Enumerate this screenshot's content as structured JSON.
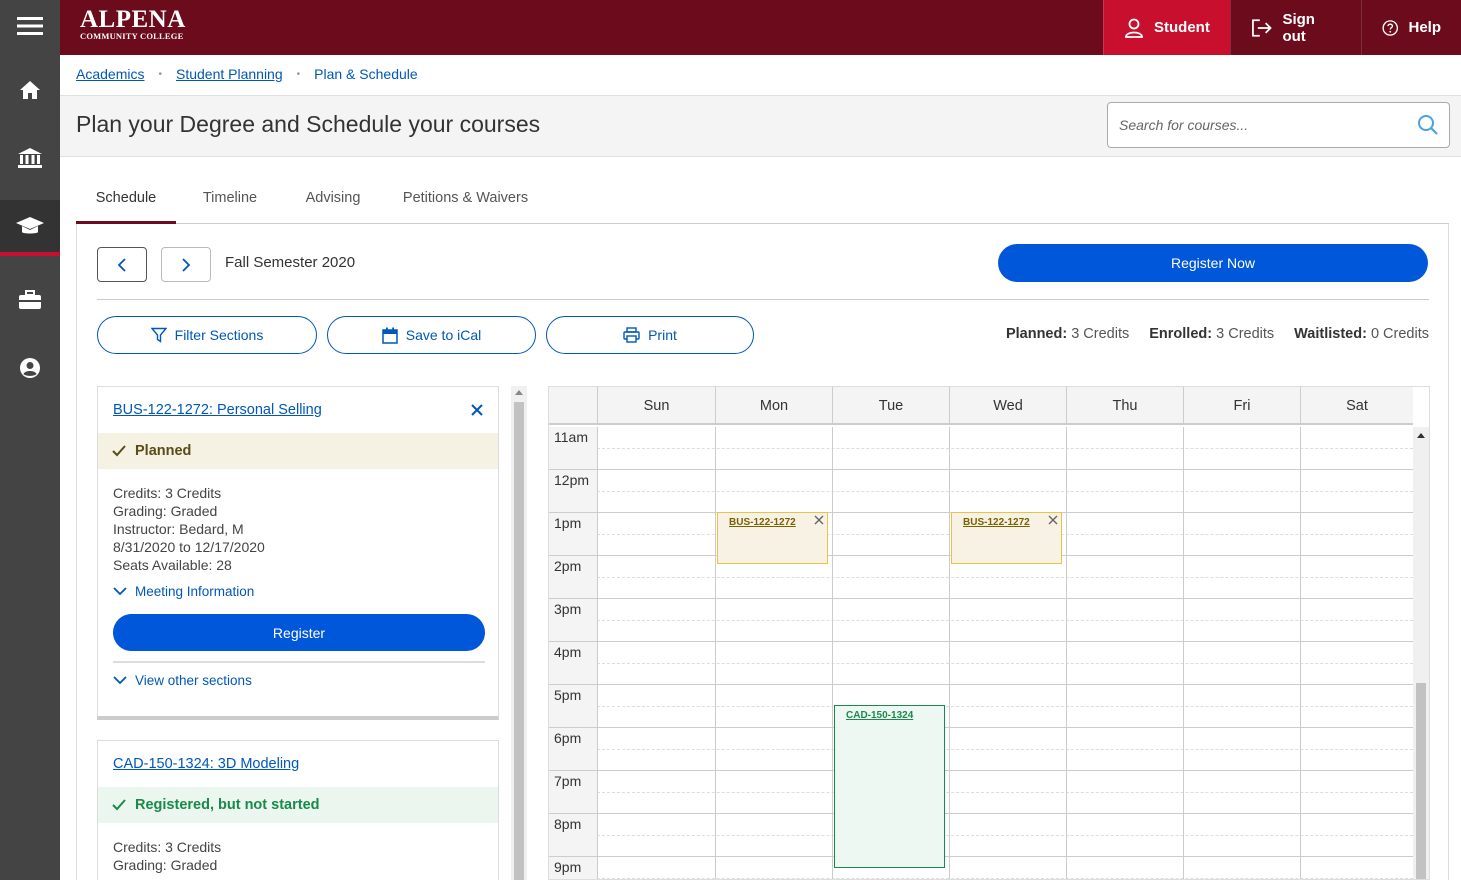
{
  "header": {
    "logo_line1": "ALPENA",
    "logo_line2": "COMMUNITY COLLEGE",
    "student_label": "Student",
    "signout_label": "Sign out",
    "help_label": "Help"
  },
  "rail": {
    "icons": [
      "menu-icon",
      "home-icon",
      "institution-icon",
      "graduation-cap-icon",
      "briefcase-icon",
      "user-circle-icon"
    ],
    "active_index": 3
  },
  "breadcrumb": {
    "items": [
      "Academics",
      "Student Planning",
      "Plan & Schedule"
    ]
  },
  "page": {
    "title": "Plan your Degree and Schedule your courses",
    "search_placeholder": "Search for courses..."
  },
  "tabs": [
    {
      "label": "Schedule",
      "active": true
    },
    {
      "label": "Timeline",
      "active": false
    },
    {
      "label": "Advising",
      "active": false
    },
    {
      "label": "Petitions & Waivers",
      "active": false
    }
  ],
  "schedule": {
    "term": "Fall Semester 2020",
    "register_now": "Register Now",
    "filter_label": "Filter Sections",
    "ical_label": "Save to iCal",
    "print_label": "Print",
    "credits": {
      "planned_label": "Planned:",
      "planned_value": "3 Credits",
      "enrolled_label": "Enrolled:",
      "enrolled_value": "3 Credits",
      "waitlisted_label": "Waitlisted:",
      "waitlisted_value": "0 Credits"
    }
  },
  "courses": [
    {
      "title": "BUS-122-1272: Personal Selling",
      "status": "Planned",
      "credits": "Credits: 3 Credits",
      "grading": "Grading: Graded",
      "instructor": "Instructor: Bedard, M",
      "dates": "8/31/2020 to 12/17/2020",
      "seats": "Seats Available:  28",
      "meeting": "Meeting Information",
      "register": "Register",
      "view_other": "View other sections"
    },
    {
      "title": "CAD-150-1324: 3D Modeling",
      "status": "Registered, but not started",
      "credits": "Credits: 3 Credits",
      "grading": "Grading: Graded"
    }
  ],
  "calendar": {
    "days": [
      "Sun",
      "Mon",
      "Tue",
      "Wed",
      "Thu",
      "Fri",
      "Sat"
    ],
    "hours": [
      "11am",
      "12pm",
      "1pm",
      "2pm",
      "3pm",
      "4pm",
      "5pm",
      "6pm",
      "7pm",
      "8pm",
      "9pm"
    ],
    "events": [
      {
        "label": "BUS-122-1272",
        "day": "Mon",
        "type": "planned"
      },
      {
        "label": "BUS-122-1272",
        "day": "Wed",
        "type": "planned"
      },
      {
        "label": "CAD-150-1324",
        "day": "Tue",
        "type": "registered"
      }
    ]
  },
  "colors": {
    "brand": "#6b0b1c",
    "accent": "#c8102e",
    "primary_button": "#0057d9",
    "link": "#0057b8",
    "planned_bg": "#f5f1e3",
    "registered_text": "#1a8a4a"
  }
}
